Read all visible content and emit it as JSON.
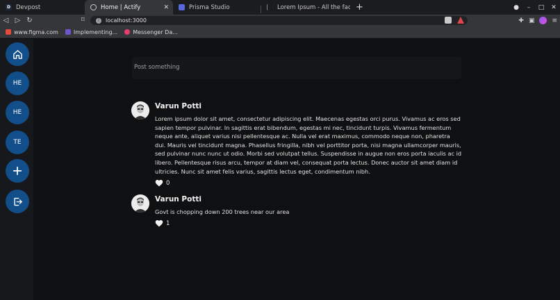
{
  "browser": {
    "tabs": [
      {
        "title": "Devpost",
        "favicon_letter": "D",
        "favicon_color": "#1b2a3a"
      },
      {
        "title": "Home | Actify",
        "active": true
      },
      {
        "title": "Prisma Studio",
        "favicon_color": "#5a67d8"
      },
      {
        "title": "Lorem Ipsum - All the facts - L",
        "favicon_color": "#888888"
      }
    ],
    "url": "localhost:3000",
    "bookmarks": [
      {
        "label": "www.figma.com",
        "color": "#e24a3b"
      },
      {
        "label": "Implementing...",
        "color": "#6e56cf"
      },
      {
        "label": "Messenger Da...",
        "color": "#e53e6b"
      }
    ]
  },
  "sidebar": {
    "items": [
      {
        "type": "icon",
        "icon": "home-icon"
      },
      {
        "type": "text",
        "label": "HE"
      },
      {
        "type": "text",
        "label": "HE"
      },
      {
        "type": "text",
        "label": "TE"
      },
      {
        "type": "icon",
        "icon": "plus-icon"
      },
      {
        "type": "icon",
        "icon": "logout-icon"
      }
    ],
    "accent": "#124e8a"
  },
  "composer": {
    "placeholder": "Post something"
  },
  "posts": [
    {
      "author": "Varun Potti",
      "body": "Lorem ipsum dolor sit amet, consectetur adipiscing elit. Maecenas egestas orci purus. Vivamus ac eros sed sapien tempor pulvinar. In sagittis erat bibendum, egestas mi nec, tincidunt turpis. Vivamus fermentum neque ante, aliquet varius nisi pellentesque ac. Nulla vel erat maximus, commodo neque non, pharetra dui. Mauris vel tincidunt magna. Phasellus fringilla, nibh vel porttitor porta, nisi magna ullamcorper mauris, sed pulvinar nunc nunc ut odio. Morbi sed volutpat tellus. Suspendisse in augue non eros porta iaculis ac id libero. Pellentesque risus arcu, tempor at diam vel, consequat porta lectus. Donec auctor sit amet diam id ultricies. Nunc sit amet felis varius, sagittis lectus eget, condimentum nibh.",
      "likes": "0"
    },
    {
      "author": "Varun Potti",
      "body": "Govt is chopping down 200 trees near our area",
      "likes": "1"
    }
  ]
}
